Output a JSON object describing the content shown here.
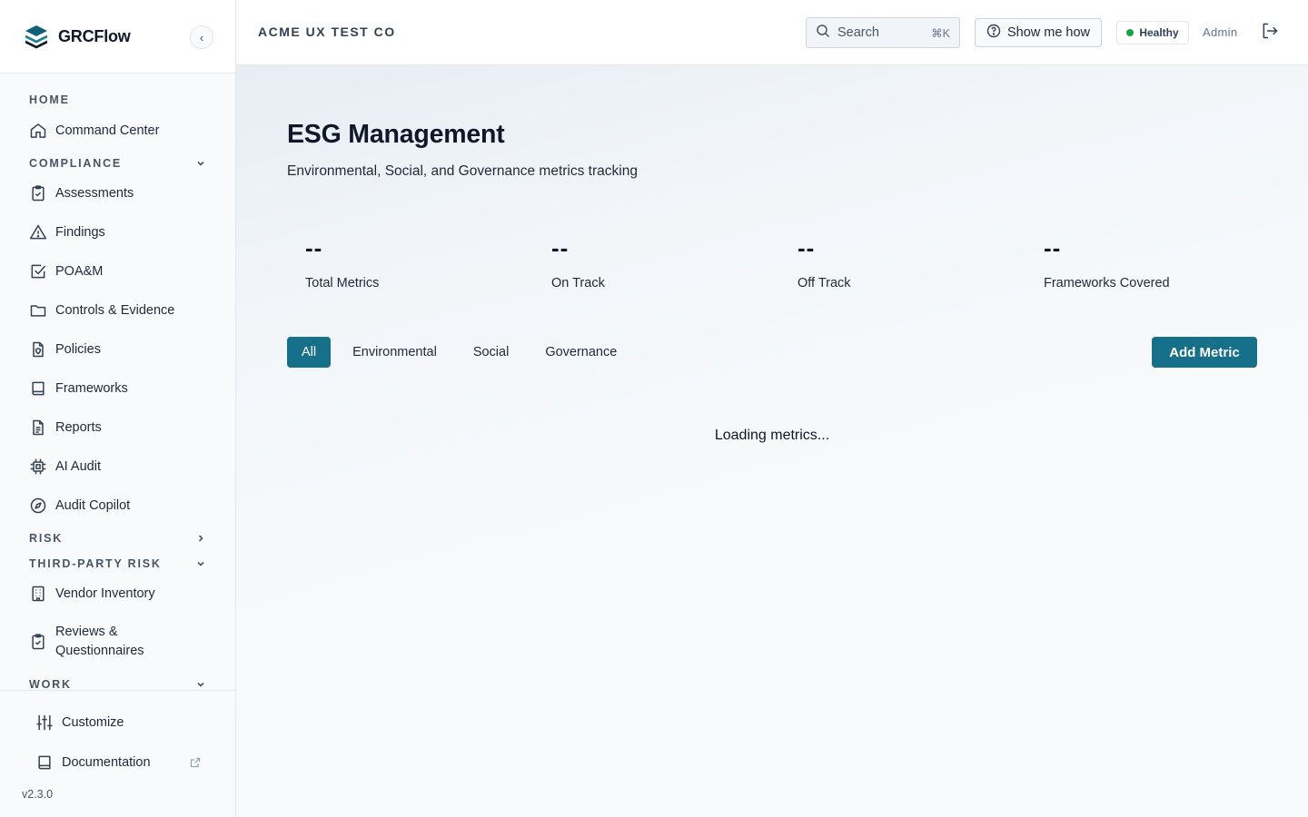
{
  "app": {
    "name": "GRCFlow",
    "version": "v2.3.0"
  },
  "colors": {
    "accent": "#16708a",
    "healthy_dot": "#16a34a"
  },
  "sidebar": {
    "collapse_glyph": "‹",
    "sections": {
      "home": "HOME",
      "compliance": "COMPLIANCE",
      "risk": "RISK",
      "third_party_risk": "THIRD-PARTY RISK",
      "work": "WORK"
    },
    "items": {
      "command_center": "Command Center",
      "assessments": "Assessments",
      "findings": "Findings",
      "poam": "POA&M",
      "controls_evidence": "Controls & Evidence",
      "policies": "Policies",
      "frameworks": "Frameworks",
      "reports": "Reports",
      "ai_audit": "AI Audit",
      "audit_copilot": "Audit Copilot",
      "vendor_inventory": "Vendor Inventory",
      "reviews_line1": "Reviews &",
      "reviews_line2": "Questionnaires"
    },
    "bottom": {
      "customize": "Customize",
      "documentation": "Documentation"
    }
  },
  "header": {
    "org_name": "ACME UX TEST CO",
    "search_label": "Search",
    "search_shortcut": "⌘K",
    "show_me_how": "Show me how",
    "health_status": "Healthy",
    "user_role": "Admin"
  },
  "page": {
    "title": "ESG Management",
    "subtitle": "Environmental, Social, and Governance metrics tracking",
    "stats": [
      {
        "value": "--",
        "label": "Total Metrics"
      },
      {
        "value": "--",
        "label": "On Track"
      },
      {
        "value": "--",
        "label": "Off Track"
      },
      {
        "value": "--",
        "label": "Frameworks Covered"
      }
    ],
    "tabs": [
      "All",
      "Environmental",
      "Social",
      "Governance"
    ],
    "active_tab": "All",
    "add_button": "Add Metric",
    "loading_text": "Loading metrics..."
  }
}
